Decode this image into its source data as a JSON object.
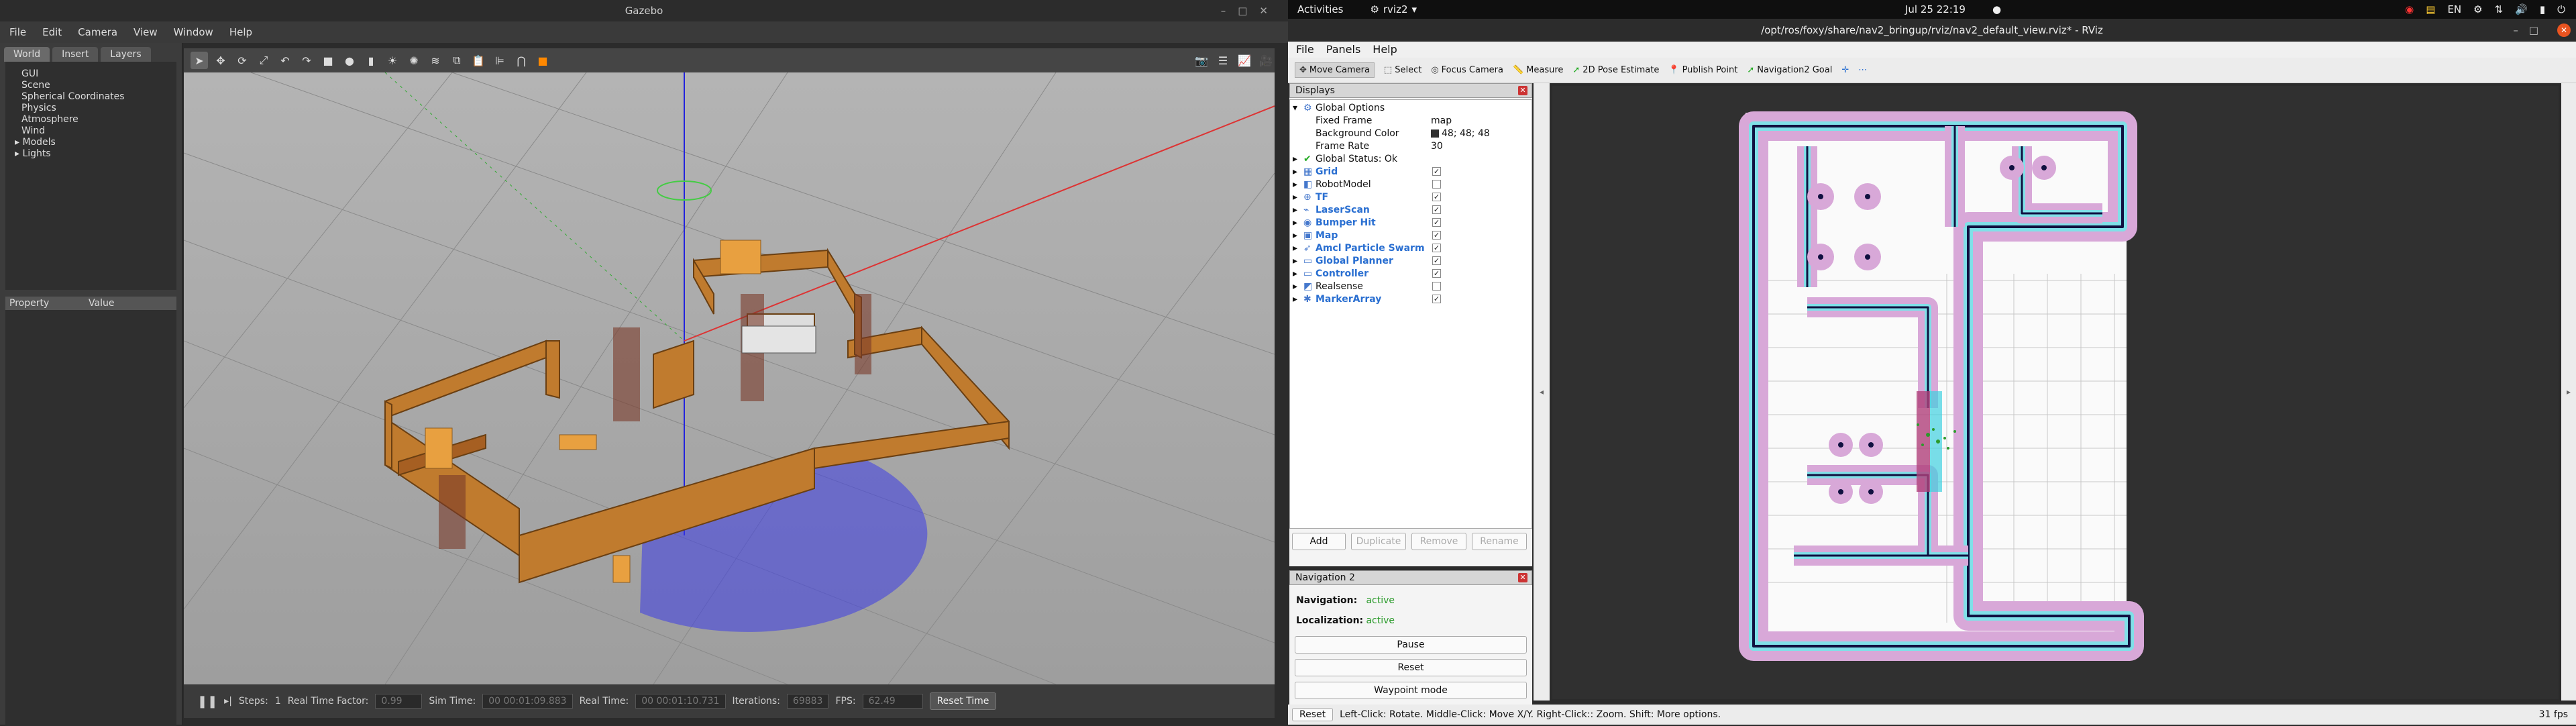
{
  "gazebo": {
    "title": "Gazebo",
    "menu": [
      "File",
      "Edit",
      "Camera",
      "View",
      "Window",
      "Help"
    ],
    "left_tabs": [
      "World",
      "Insert",
      "Layers"
    ],
    "world_tree": [
      "GUI",
      "Scene",
      "Spherical Coordinates",
      "Physics",
      "Atmosphere",
      "Wind",
      "Models",
      "Lights"
    ],
    "prop_headers": {
      "property": "Property",
      "value": "Value"
    },
    "bottom": {
      "steps_label": "Steps:",
      "steps_value": "1",
      "rtf_label": "Real Time Factor:",
      "rtf_value": "0.99",
      "sim_label": "Sim Time:",
      "sim_value": "00 00:01:09.883",
      "real_label": "Real Time:",
      "real_value": "00 00:01:10.731",
      "iter_label": "Iterations:",
      "iter_value": "69883",
      "fps_label": "FPS:",
      "fps_value": "62.49",
      "reset_label": "Reset Time"
    }
  },
  "topbar": {
    "activities": "Activities",
    "app": "rviz2",
    "clock": "Jul 25  22:19",
    "lang": "EN"
  },
  "rviz": {
    "title": "/opt/ros/foxy/share/nav2_bringup/rviz/nav2_default_view.rviz* - RViz",
    "menu": [
      "File",
      "Panels",
      "Help"
    ],
    "tools": [
      "Move Camera",
      "Select",
      "Focus Camera",
      "Measure",
      "2D Pose Estimate",
      "Publish Point",
      "Navigation2 Goal"
    ],
    "displays_title": "Displays",
    "global_options": "Global Options",
    "fixed_frame_label": "Fixed Frame",
    "fixed_frame_value": "map",
    "bg_label": "Background Color",
    "bg_value": "48; 48; 48",
    "fr_label": "Frame Rate",
    "fr_value": "30",
    "global_status": "Global Status: Ok",
    "displays": [
      {
        "name": "Grid",
        "checked": true,
        "blue": true
      },
      {
        "name": "RobotModel",
        "checked": false,
        "blue": false
      },
      {
        "name": "TF",
        "checked": true,
        "blue": true
      },
      {
        "name": "LaserScan",
        "checked": true,
        "blue": true
      },
      {
        "name": "Bumper Hit",
        "checked": true,
        "blue": true
      },
      {
        "name": "Map",
        "checked": true,
        "blue": true
      },
      {
        "name": "Amcl Particle Swarm",
        "checked": true,
        "blue": true
      },
      {
        "name": "Global Planner",
        "checked": true,
        "blue": true
      },
      {
        "name": "Controller",
        "checked": true,
        "blue": true
      },
      {
        "name": "Realsense",
        "checked": false,
        "blue": false
      },
      {
        "name": "MarkerArray",
        "checked": true,
        "blue": true
      }
    ],
    "buttons": {
      "add": "Add",
      "duplicate": "Duplicate",
      "remove": "Remove",
      "rename": "Rename"
    },
    "nav_title": "Navigation 2",
    "navigation_label": "Navigation:",
    "navigation_value": "active",
    "localization_label": "Localization:",
    "localization_value": "active",
    "pause": "Pause",
    "reset": "Reset",
    "waypoint": "Waypoint mode",
    "status_reset": "Reset",
    "status_text": "Left-Click: Rotate. Middle-Click: Move X/Y. Right-Click:: Zoom. Shift: More options.",
    "fps": "31 fps"
  }
}
